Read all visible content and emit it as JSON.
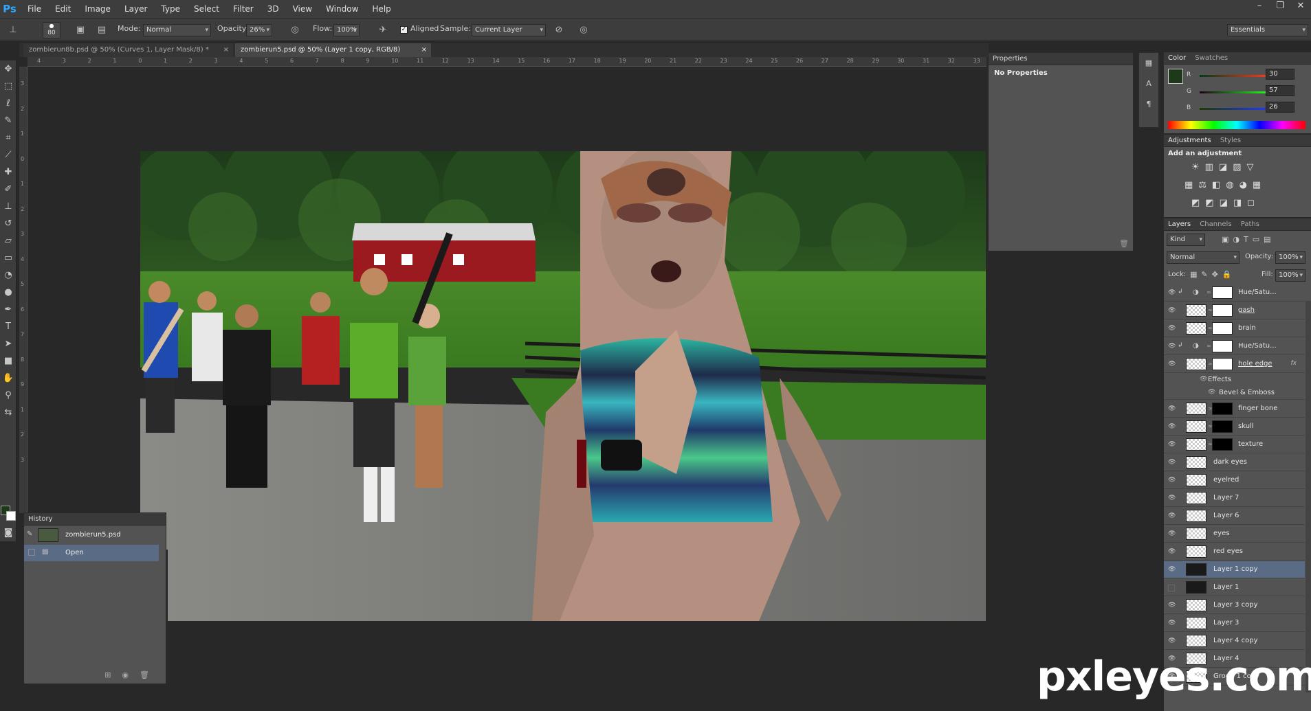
{
  "app": {
    "logo": "Ps"
  },
  "menu": [
    "File",
    "Edit",
    "Image",
    "Layer",
    "Type",
    "Select",
    "Filter",
    "3D",
    "View",
    "Window",
    "Help"
  ],
  "window_controls": [
    "–",
    "❐",
    "✕"
  ],
  "options": {
    "brush_size": "80",
    "mode_label": "Mode:",
    "mode": "Normal",
    "opacity_label": "Opacity:",
    "opacity": "26%",
    "flow_label": "Flow:",
    "flow": "100%",
    "aligned": "Aligned",
    "sample_label": "Sample:",
    "sample": "Current Layer",
    "workspace": "Essentials"
  },
  "tabs": [
    {
      "title": "zombierun8b.psd @ 50% (Curves 1, Layer Mask/8) *",
      "close": "×"
    },
    {
      "title": "zombierun5.psd @ 50% (Layer 1 copy, RGB/8)",
      "close": "×"
    }
  ],
  "ruler_h": [
    "4",
    "3",
    "2",
    "1",
    "0",
    "1",
    "2",
    "3",
    "4",
    "5",
    "6",
    "7",
    "8",
    "9",
    "10",
    "11",
    "12",
    "13",
    "14",
    "15",
    "16",
    "17",
    "18",
    "19",
    "20",
    "21",
    "22",
    "23",
    "24",
    "25",
    "26",
    "27",
    "28",
    "29",
    "30",
    "31",
    "32",
    "33"
  ],
  "ruler_v": [
    "3",
    "2",
    "1",
    "0",
    "1",
    "2",
    "3",
    "4",
    "5",
    "6",
    "7",
    "8",
    "9",
    "1",
    "2",
    "3"
  ],
  "properties": {
    "title": "Properties",
    "content": "No Properties"
  },
  "color": {
    "tab1": "Color",
    "tab2": "Swatches",
    "r_label": "R",
    "g_label": "G",
    "b_label": "B",
    "r": "30",
    "g": "57",
    "b": "26",
    "fg": "#1e391a"
  },
  "adjustments": {
    "tab1": "Adjustments",
    "tab2": "Styles",
    "heading": "Add an adjustment"
  },
  "layers": {
    "tabs": [
      "Layers",
      "Channels",
      "Paths"
    ],
    "kind": "Kind",
    "blend": "Normal",
    "opacity_label": "Opacity:",
    "opacity": "100%",
    "lock_label": "Lock:",
    "fill_label": "Fill:",
    "fill": "100%",
    "rows": [
      {
        "name": "Hue/Satu...",
        "type": "adj"
      },
      {
        "name": "gash",
        "type": "masked"
      },
      {
        "name": "brain",
        "type": "masked"
      },
      {
        "name": "Hue/Satu...",
        "type": "adj"
      },
      {
        "name": "hole edge",
        "type": "masked",
        "fx": "fx"
      },
      {
        "name": "Effects",
        "type": "effects"
      },
      {
        "name": "Bevel & Emboss",
        "type": "effect"
      },
      {
        "name": "finger bone",
        "type": "darkmask"
      },
      {
        "name": "skull",
        "type": "darkmask"
      },
      {
        "name": "texture",
        "type": "darkmask"
      },
      {
        "name": "dark eyes",
        "type": "plain"
      },
      {
        "name": "eyelred",
        "type": "plain"
      },
      {
        "name": "Layer 7",
        "type": "plain"
      },
      {
        "name": "Layer 6",
        "type": "plain"
      },
      {
        "name": "eyes",
        "type": "plain"
      },
      {
        "name": "red eyes",
        "type": "plain"
      },
      {
        "name": "Layer 1 copy",
        "type": "photo",
        "selected": true
      },
      {
        "name": "Layer 1",
        "type": "photo",
        "hidden": true
      },
      {
        "name": "Layer 3 copy",
        "type": "plain"
      },
      {
        "name": "Layer 3",
        "type": "plain"
      },
      {
        "name": "Layer 4 copy",
        "type": "plain"
      },
      {
        "name": "Layer 4",
        "type": "plain"
      },
      {
        "name": "Group 1 copy",
        "type": "plain"
      }
    ]
  },
  "history": {
    "title": "History",
    "snapshot": "zombierun5.psd",
    "step": "Open"
  },
  "watermark": "pxleyes.com"
}
